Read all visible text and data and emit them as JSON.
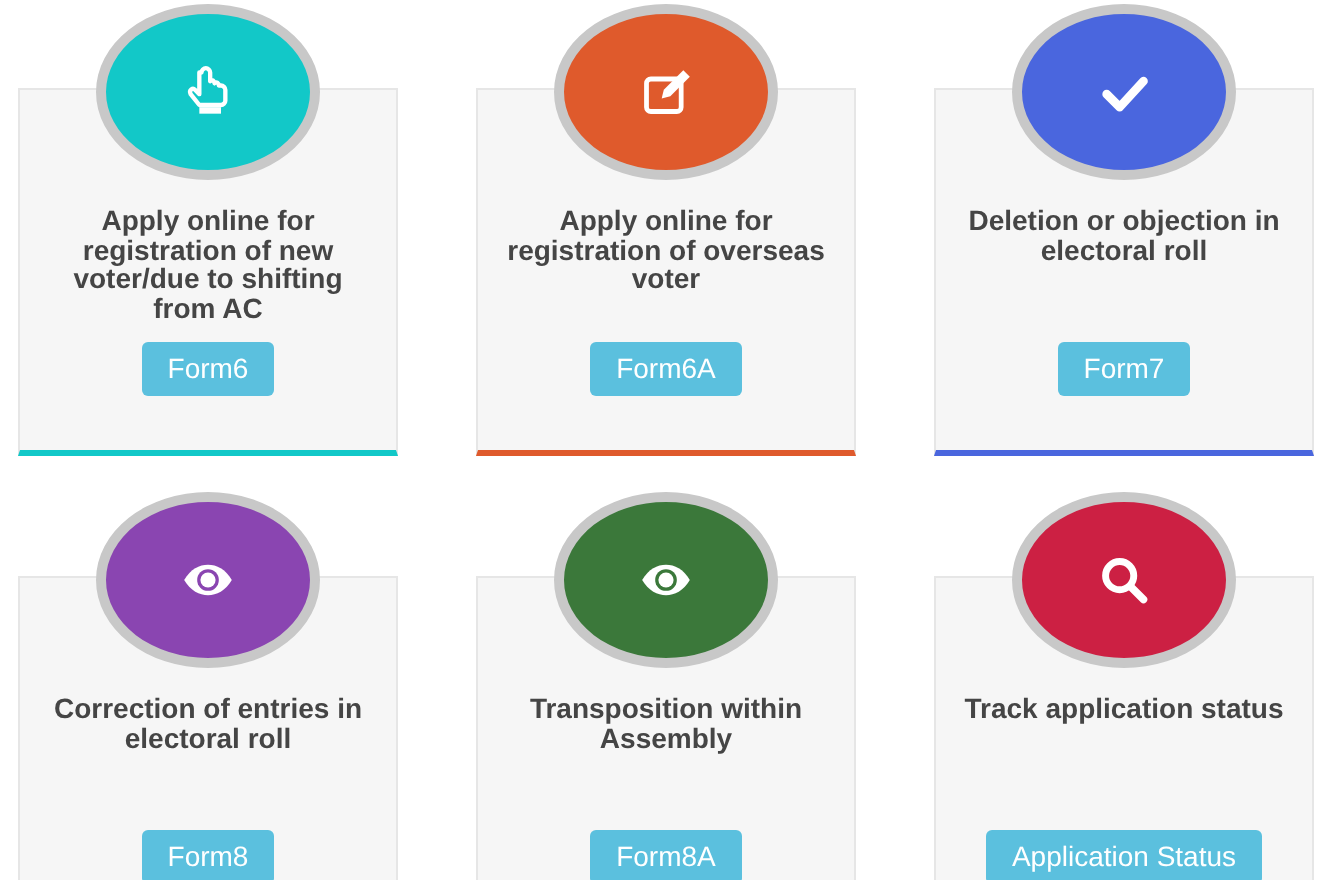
{
  "cards": [
    {
      "color": "#12c8c8",
      "title": "Apply online for registration of new voter/due to shifting from AC",
      "button": "Form6"
    },
    {
      "color": "#df5a2c",
      "title": "Apply online for registration of overseas voter",
      "button": "Form6A"
    },
    {
      "color": "#4a66de",
      "title": "Deletion or objection in electoral roll",
      "button": "Form7"
    },
    {
      "color": "#8a45b1",
      "title": "Correction of entries in electoral roll",
      "button": "Form8"
    },
    {
      "color": "#3b783a",
      "title": "Transposition within Assembly",
      "button": "Form8A"
    },
    {
      "color": "#cc2043",
      "title": "Track application status",
      "button": "Application Status"
    }
  ]
}
